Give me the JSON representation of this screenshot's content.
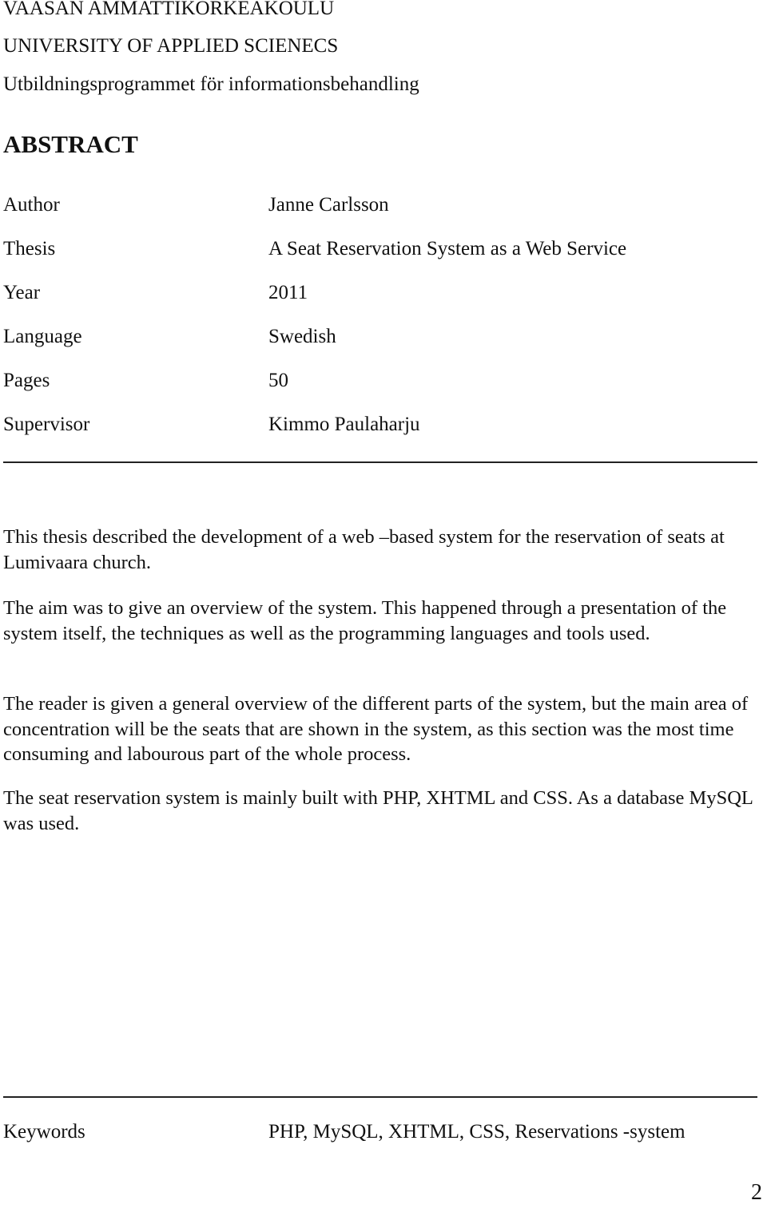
{
  "header": {
    "institution": "VAASAN AMMATTIKORKEAKOULU",
    "institution_en": "UNIVERSITY OF APPLIED SCIENECS",
    "programme": "Utbildningsprogrammet för informationsbehandling"
  },
  "title": "ABSTRACT",
  "meta": [
    {
      "label": "Author",
      "value": "Janne Carlsson"
    },
    {
      "label": "Thesis",
      "value": "A Seat Reservation System as a Web Service"
    },
    {
      "label": "Year",
      "value": "2011"
    },
    {
      "label": "Language",
      "value": "Swedish"
    },
    {
      "label": "Pages",
      "value": "50"
    },
    {
      "label": "Supervisor",
      "value": "Kimmo Paulaharju"
    }
  ],
  "abstract": {
    "paragraphs": [
      "This thesis described the development of a web –based system for the reservation of seats at Lumivaara church.",
      "The aim was to give an overview of the system. This happened through a presentation of the system itself, the techniques as well as the programming languages and tools used.",
      "The reader is given a general overview of the different parts of the system, but the main area of concentration will be the seats that are shown in the system, as this section was the most time consuming and labourous part of the whole process.",
      "The seat reservation system is mainly built with PHP, XHTML and CSS. As a database MySQL was used."
    ]
  },
  "keywords": {
    "label": "Keywords",
    "value": "PHP, MySQL, XHTML, CSS, Reservations -system"
  },
  "page_number": "2"
}
